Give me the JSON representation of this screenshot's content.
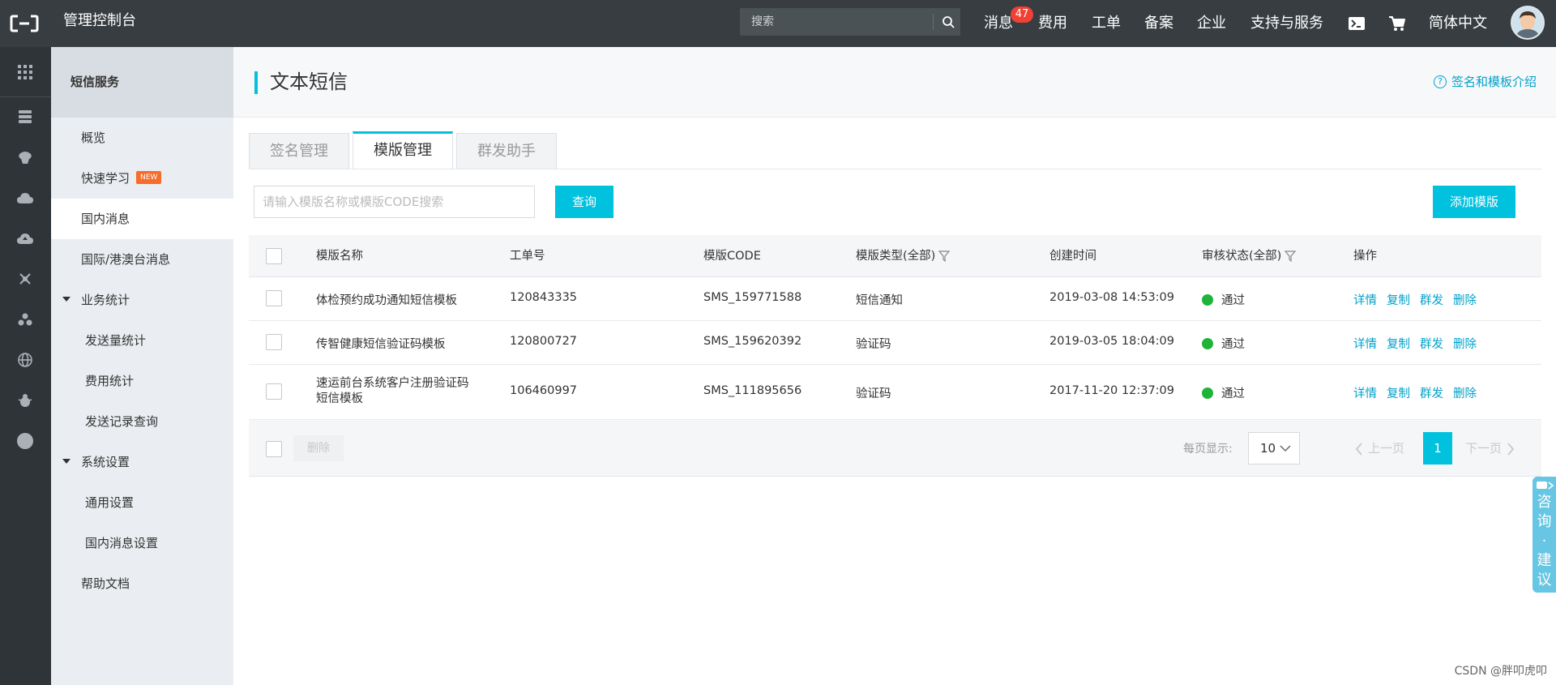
{
  "topbar": {
    "app_title": "管理控制台",
    "search_placeholder": "搜索",
    "nav": {
      "messages": "消息",
      "messages_badge": "47",
      "billing": "费用",
      "tickets": "工单",
      "icp": "备案",
      "enterprise": "企业",
      "support": "支持与服务",
      "language": "简体中文"
    }
  },
  "sidebar": {
    "header": "短信服务",
    "items": [
      {
        "label": "概览"
      },
      {
        "label": "快速学习",
        "tag": "NEW"
      },
      {
        "label": "国内消息"
      },
      {
        "label": "国际/港澳台消息"
      },
      {
        "label": "业务统计"
      },
      {
        "label": "发送量统计"
      },
      {
        "label": "费用统计"
      },
      {
        "label": "发送记录查询"
      },
      {
        "label": "系统设置"
      },
      {
        "label": "通用设置"
      },
      {
        "label": "国内消息设置"
      },
      {
        "label": "帮助文档"
      }
    ]
  },
  "main": {
    "title": "文本短信",
    "help_link": "签名和模板介绍",
    "help_icon": "?",
    "tabs": [
      {
        "label": "签名管理"
      },
      {
        "label": "模版管理"
      },
      {
        "label": "群发助手"
      }
    ],
    "search_placeholder": "请输入模版名称或模版CODE搜索",
    "query_button": "查询",
    "add_button": "添加模版"
  },
  "table": {
    "columns": [
      "模版名称",
      "工单号",
      "模版CODE",
      "模版类型(全部)",
      "创建时间",
      "审核状态(全部)",
      "操作"
    ],
    "rows": [
      {
        "name": "体检预约成功通知短信模板",
        "ticket": "120843335",
        "code": "SMS_159771588",
        "type": "短信通知",
        "created": "2019-03-08 14:53:09",
        "status": "通过"
      },
      {
        "name": "传智健康短信验证码模板",
        "ticket": "120800727",
        "code": "SMS_159620392",
        "type": "验证码",
        "created": "2019-03-05 18:04:09",
        "status": "通过"
      },
      {
        "name_line1": "速运前台系统客户注册验证码",
        "name_line2": "短信模板",
        "ticket": "106460997",
        "code": "SMS_111895656",
        "type": "验证码",
        "created": "2017-11-20 12:37:09",
        "status": "通过"
      }
    ],
    "actions": [
      "详情",
      "复制",
      "群发",
      "删除"
    ],
    "footer": {
      "delete": "删除",
      "per_page_label": "每页显示:",
      "per_page": "10",
      "prev": "上一页",
      "current_page": "1",
      "next": "下一页"
    }
  },
  "consult": {
    "chars": [
      "咨",
      "询",
      "·",
      "建",
      "议"
    ]
  },
  "watermark": "CSDN @胖叩虎叩",
  "colors": {
    "topbar": "#373d41",
    "accent": "#00c1de",
    "link": "#00a2ca",
    "success": "#1fb439",
    "badge": "#f04134"
  }
}
